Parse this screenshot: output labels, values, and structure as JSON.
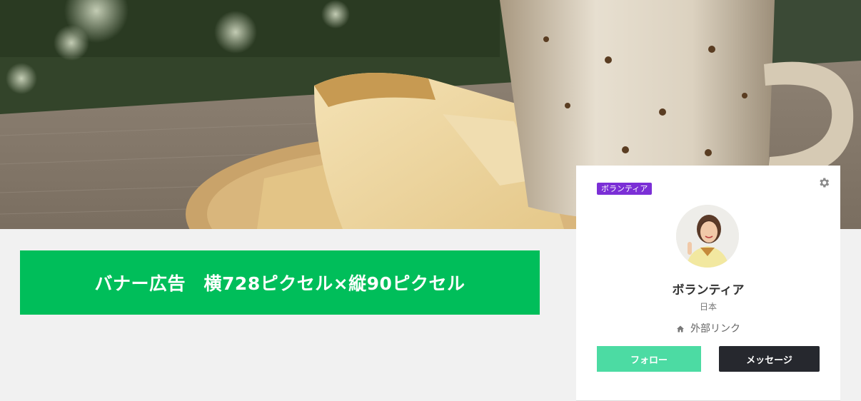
{
  "banner": {
    "text": "バナー広告　横728ピクセル×縦90ピクセル",
    "color": "#00be5a"
  },
  "profile": {
    "badge": "ボランティア",
    "badge_color": "#7b2fd6",
    "name": "ボランティア",
    "country": "日本",
    "external_link": "外部リンク",
    "follow_label": "フォロー",
    "message_label": "メッセージ",
    "follow_color": "#4cdba3",
    "message_color": "#26282e",
    "icons": [
      "gear-icon",
      "home-icon"
    ]
  }
}
